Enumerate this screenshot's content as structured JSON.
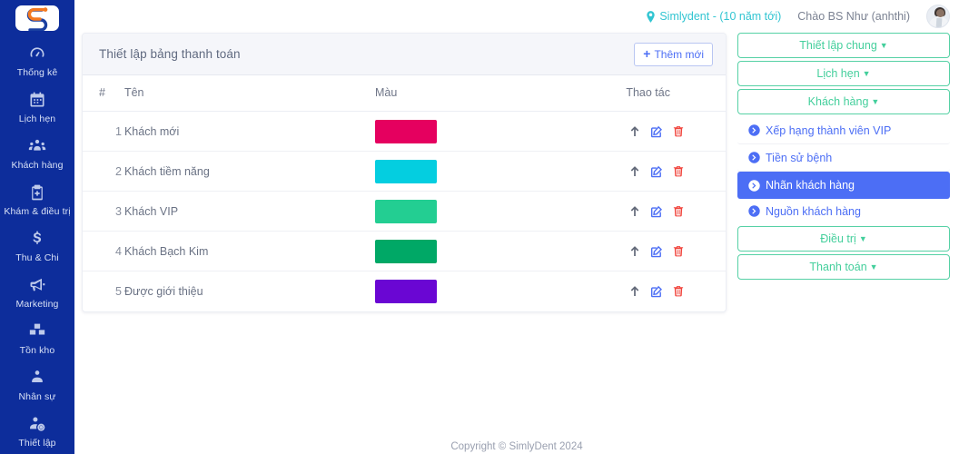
{
  "brand": {
    "logo_icon": "simlydent-logo-icon",
    "name": "SimlyDent"
  },
  "leftnav": {
    "items": [
      {
        "label": "Thống kê",
        "icon": "dashboard-icon"
      },
      {
        "label": "Lịch hẹn",
        "icon": "calendar-icon"
      },
      {
        "label": "Khách hàng",
        "icon": "users-icon"
      },
      {
        "label": "Khám & điều trị",
        "icon": "clipboard-plus-icon"
      },
      {
        "label": "Thu & Chi",
        "icon": "dollar-icon"
      },
      {
        "label": "Marketing",
        "icon": "megaphone-icon"
      },
      {
        "label": "Tồn kho",
        "icon": "boxes-icon"
      },
      {
        "label": "Nhân sự",
        "icon": "user-group-icon"
      },
      {
        "label": "Thiết lập",
        "icon": "user-gear-icon"
      }
    ]
  },
  "topbar": {
    "clinic_icon": "location-pin-icon",
    "clinic": "Simlydent - (10 năm tới)",
    "greeting": "Chào BS Như (anhthi)",
    "avatar_icon": "user-avatar"
  },
  "card": {
    "title": "Thiết lập bảng thanh toán",
    "add_button": {
      "label": "Thêm mới",
      "icon": "plus-icon"
    },
    "columns": [
      "#",
      "Tên",
      "Màu",
      "Thao tác"
    ],
    "rows": [
      {
        "index": "1",
        "name": "Khách mới",
        "color": "#E5005F"
      },
      {
        "index": "2",
        "name": "Khách tiềm năng",
        "color": "#04CEE0"
      },
      {
        "index": "3",
        "name": "Khách VIP",
        "color": "#23CE92"
      },
      {
        "index": "4",
        "name": "Khách Bạch Kim",
        "color": "#00A866"
      },
      {
        "index": "5",
        "name": "Được giới thiệu",
        "color": "#6A06D3"
      }
    ],
    "row_actions": [
      {
        "icon": "arrow-up-icon",
        "title": "Lên"
      },
      {
        "icon": "edit-icon",
        "title": "Sửa"
      },
      {
        "icon": "trash-icon",
        "title": "Xóa"
      }
    ]
  },
  "panel": {
    "groups": [
      {
        "label": "Thiết lập chung",
        "caret": "▼",
        "expanded": false
      },
      {
        "label": "Lịch hẹn",
        "caret": "▼",
        "expanded": false
      },
      {
        "label": "Khách hàng",
        "caret": "▼",
        "expanded": true
      }
    ],
    "sub_items": [
      {
        "label": "Xếp hạng thành viên VIP",
        "active": false
      },
      {
        "label": "Tiền sử bệnh",
        "active": false
      },
      {
        "label": "Nhãn khách hàng",
        "active": true
      },
      {
        "label": "Nguồn khách hàng",
        "active": false
      }
    ],
    "groups_after": [
      {
        "label": "Điều trị",
        "caret": "▼"
      },
      {
        "label": "Thanh toán",
        "caret": "▼"
      }
    ]
  },
  "footer": {
    "text": "Copyright © SimlyDent 2024"
  },
  "colors": {
    "nav_bg": "#0D2D9B",
    "accent_blue": "#4C6EF5",
    "accent_green": "#44CF9C",
    "danger": "#F1453D",
    "teal": "#32C5D2",
    "card_head": "#F5F6FA"
  }
}
